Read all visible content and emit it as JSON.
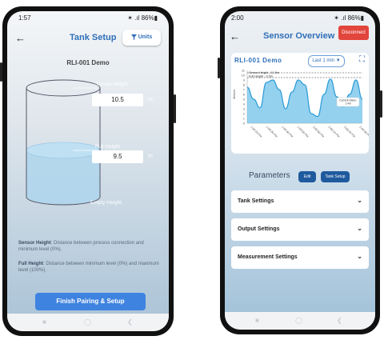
{
  "tank_setup": {
    "status": {
      "time": "1:57",
      "icons": "✶ .ıl 86%▮"
    },
    "title": "Tank Setup",
    "units_label": "Units",
    "device_name": "RLI-001 Demo",
    "sensor_height": {
      "label": "Sensor Height",
      "value": "10.5",
      "unit": "m"
    },
    "full_height": {
      "label": "Full Height",
      "value": "9.5",
      "unit": "m"
    },
    "empty_height_label": "Empty Height",
    "descriptions": [
      {
        "term": "Sensor Height",
        "text": ": Distance between process connection and minimum level (0%)."
      },
      {
        "term": "Full Height",
        "text": ": Distance between minimum level (0%) and maximum level (100%)."
      }
    ],
    "finish_button": "Finish Pairing & Setup"
  },
  "sensor_overview": {
    "status": {
      "time": "2:00",
      "icons": "✶ .ıl 86%▮"
    },
    "title": "Sensor Overview",
    "disconnect_label": "Disconnect",
    "chart_title": "RLI-001 Demo",
    "range_label": "Last 1 min",
    "tooltip": "Current Value:\n1.4m",
    "legend": [
      "Sensor Height - 10.5m",
      "Full Height - 9.5m"
    ],
    "parameters_title": "Parameters",
    "edit_label": "Edit",
    "tank_setup_label": "Tank Setup",
    "sections": [
      "Tank Settings",
      "Output Settings",
      "Measurement Settings"
    ]
  },
  "chart_data": {
    "type": "area",
    "title": "RLI-001 Demo",
    "ylabel": "Meters",
    "ylim": [
      0,
      11
    ],
    "yticks": [
      "0",
      "1",
      "2",
      "3",
      "4",
      "5",
      "6",
      "7",
      "8",
      "9",
      "10",
      "11"
    ],
    "x": [
      "1:59:20 PM",
      "1:59:30 PM",
      "1:59:40 PM",
      "1:59:50 PM",
      "2:00:00 PM",
      "2:00:10 PM",
      "2:00:20 PM",
      "2:00:30 PM"
    ],
    "series": [
      {
        "values": [
          7.5,
          5.0,
          3.2,
          8.5,
          9.0,
          7.0,
          3.0,
          6.5,
          9.0,
          8.0,
          2.0,
          1.4,
          6.0,
          9.2,
          5.5,
          3.5,
          6.0,
          9.0,
          5.0
        ]
      }
    ],
    "reference_lines": [
      {
        "name": "Sensor Height - 10.5m",
        "value": 10.5
      },
      {
        "name": "Full Height - 9.5m",
        "value": 9.5
      }
    ],
    "colors": {
      "line": "#2b9bd6",
      "fill": "#6fc1ea"
    }
  },
  "colors": {
    "accent": "#2f6fb8",
    "danger": "#e2453c",
    "button": "#3f83e0"
  }
}
